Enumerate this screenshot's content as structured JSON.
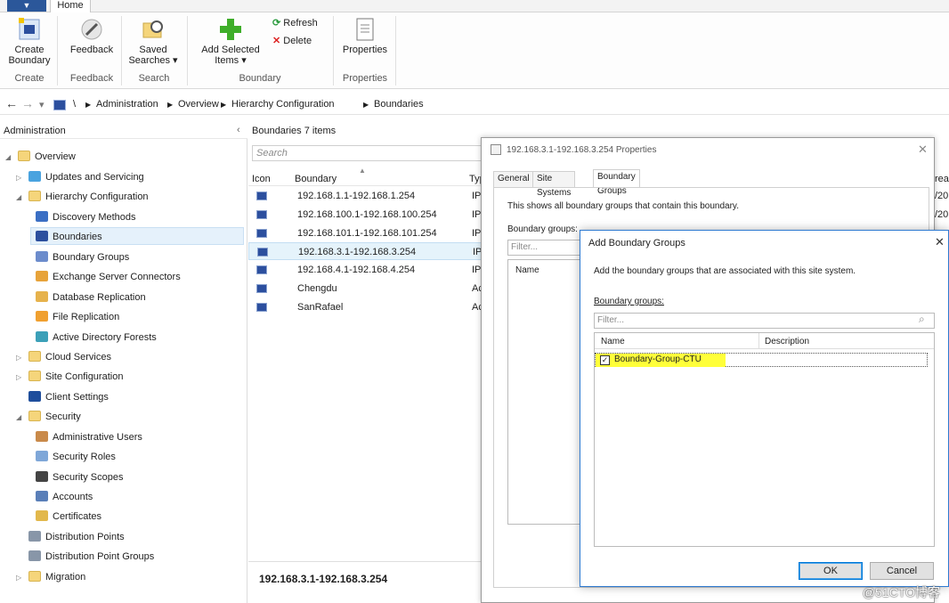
{
  "ribbon": {
    "file_tab": "▼",
    "home_tab": "Home",
    "buttons": {
      "create_boundary": "Create Boundary",
      "feedback": "Feedback",
      "saved_searches": "Saved Searches ▾",
      "add_selected": "Add Selected Items ▾",
      "refresh": "Refresh",
      "delete": "Delete",
      "properties": "Properties"
    },
    "groups": [
      "Create",
      "Feedback",
      "Search",
      "Boundary",
      "Properties"
    ]
  },
  "address": {
    "path": [
      "\\",
      "Administration",
      "Overview",
      "Hierarchy Configuration",
      "Boundaries"
    ]
  },
  "nav": {
    "title": "Administration",
    "collapse_glyph": "‹",
    "items": [
      {
        "label": "Overview"
      },
      {
        "label": "Updates and Servicing"
      },
      {
        "label": "Hierarchy Configuration"
      },
      {
        "label": "Discovery Methods"
      },
      {
        "label": "Boundaries"
      },
      {
        "label": "Boundary Groups"
      },
      {
        "label": "Exchange Server Connectors"
      },
      {
        "label": "Database Replication"
      },
      {
        "label": "File Replication"
      },
      {
        "label": "Active Directory Forests"
      },
      {
        "label": "Cloud Services"
      },
      {
        "label": "Site Configuration"
      },
      {
        "label": "Client Settings"
      },
      {
        "label": "Security"
      },
      {
        "label": "Administrative Users"
      },
      {
        "label": "Security Roles"
      },
      {
        "label": "Security Scopes"
      },
      {
        "label": "Accounts"
      },
      {
        "label": "Certificates"
      },
      {
        "label": "Distribution Points"
      },
      {
        "label": "Distribution Point Groups"
      },
      {
        "label": "Migration"
      }
    ]
  },
  "list": {
    "header": "Boundaries 7 items",
    "search_placeholder": "Search",
    "columns": [
      "Icon",
      "Boundary",
      "Typ"
    ],
    "rows": [
      {
        "boundary": "192.168.1.1-192.168.1.254",
        "type": "IP"
      },
      {
        "boundary": "192.168.100.1-192.168.100.254",
        "type": "IP"
      },
      {
        "boundary": "192.168.101.1-192.168.101.254",
        "type": "IP"
      },
      {
        "boundary": "192.168.3.1-192.168.3.254",
        "type": "IP"
      },
      {
        "boundary": "192.168.4.1-192.168.4.254",
        "type": "IP"
      },
      {
        "boundary": "Chengdu",
        "type": "Ac"
      },
      {
        "boundary": "SanRafael",
        "type": "Ac"
      }
    ],
    "right_col_header": "rea",
    "right_col_values": [
      "/20",
      "/20"
    ],
    "details_title": "192.168.3.1-192.168.3.254"
  },
  "props_dialog": {
    "title": "192.168.3.1-192.168.3.254 Properties",
    "close": "✕",
    "tabs": [
      "General",
      "Site Systems",
      "Boundary Groups"
    ],
    "description": "This shows all boundary groups that contain this boundary.",
    "groups_label": "Boundary groups:",
    "filter_placeholder": "Filter...",
    "name_col": "Name"
  },
  "add_dialog": {
    "title": "Add Boundary Groups",
    "close": "✕",
    "description": "Add the boundary groups that are associated with this site system.",
    "groups_label": "Boundary groups:",
    "filter_placeholder": "Filter...",
    "columns": [
      "Name",
      "Description"
    ],
    "items": [
      {
        "name": "Boundary-Group-CTU",
        "checked": true
      }
    ],
    "ok": "OK",
    "cancel": "Cancel"
  },
  "watermark": "@51CTO博客",
  "colors": {
    "highlight": "#ffff3a",
    "selection": "#e5f1fb",
    "dialog_border": "#2e7ad1"
  }
}
